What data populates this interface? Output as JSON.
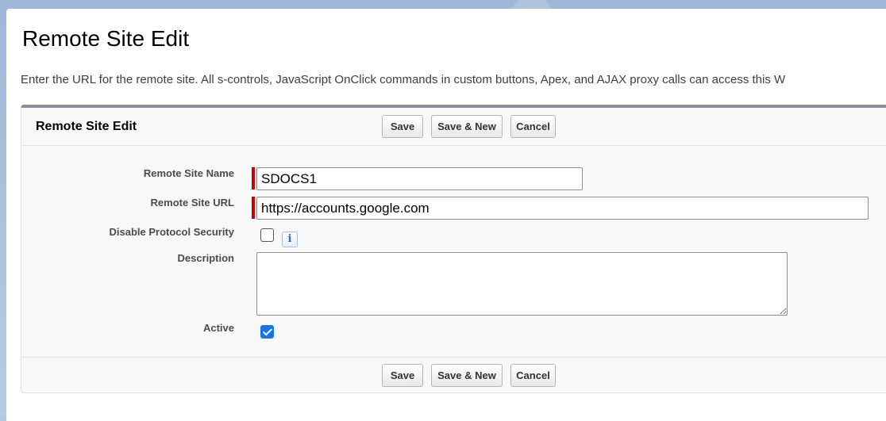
{
  "page": {
    "title": "Remote Site Edit",
    "intro": "Enter the URL for the remote site. All s-controls, JavaScript OnClick commands in custom buttons, Apex, and AJAX proxy calls can access this W"
  },
  "block": {
    "title": "Remote Site Edit",
    "buttons": {
      "save": "Save",
      "save_new": "Save & New",
      "cancel": "Cancel"
    }
  },
  "form": {
    "name": {
      "label": "Remote Site Name",
      "value": "SDOCS1"
    },
    "url": {
      "label": "Remote Site URL",
      "value": "https://accounts.google.com"
    },
    "disable_protocol_security": {
      "label": "Disable Protocol Security",
      "checked": false,
      "info_icon": "info-icon"
    },
    "description": {
      "label": "Description",
      "value": ""
    },
    "active": {
      "label": "Active",
      "checked": true
    }
  },
  "colors": {
    "required_bar": "#cc0000",
    "checkbox_checked": "#1b73e8",
    "block_top_border": "#8a8f9a"
  }
}
